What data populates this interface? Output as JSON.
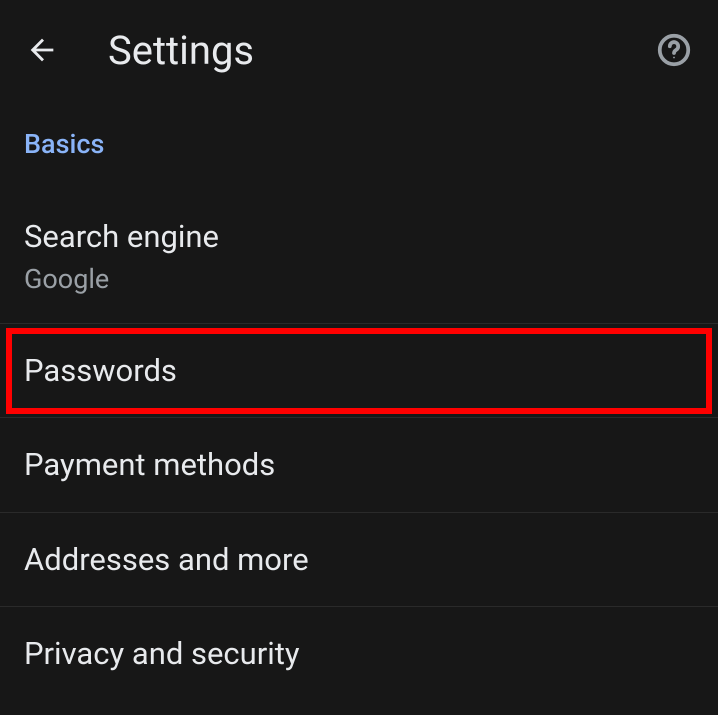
{
  "header": {
    "title": "Settings"
  },
  "section": {
    "label": "Basics"
  },
  "items": {
    "search_engine": {
      "title": "Search engine",
      "subtitle": "Google"
    },
    "passwords": {
      "title": "Passwords"
    },
    "payment_methods": {
      "title": "Payment methods"
    },
    "addresses": {
      "title": "Addresses and more"
    },
    "privacy": {
      "title": "Privacy and security"
    }
  }
}
